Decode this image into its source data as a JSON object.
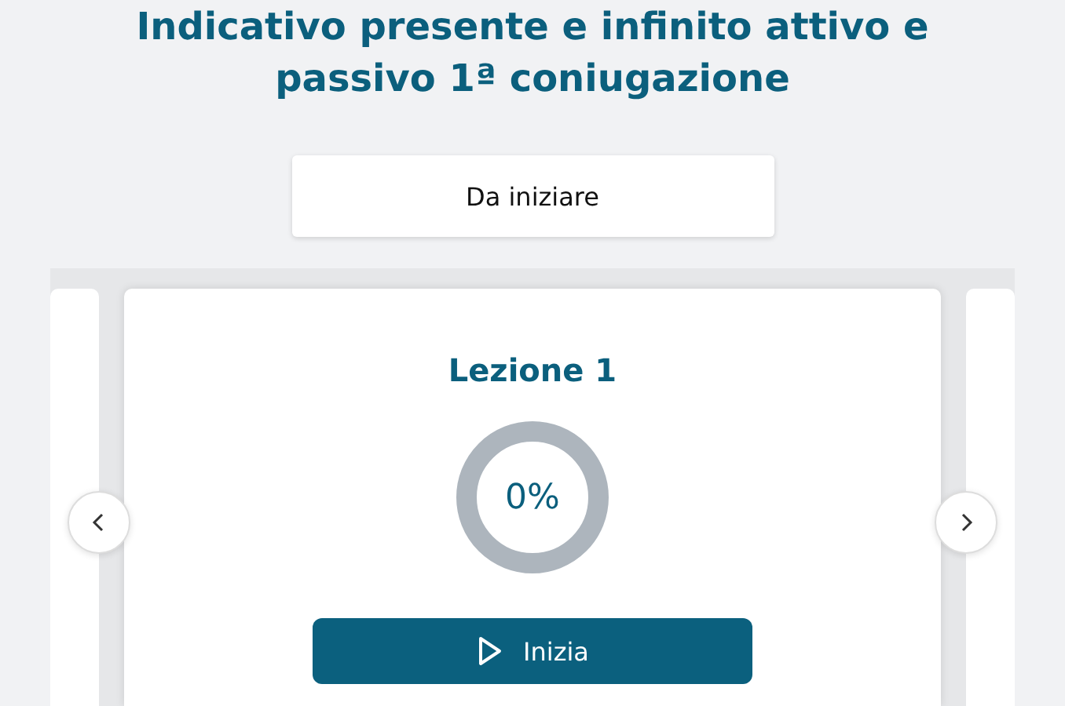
{
  "title": "Indicativo presente e infinito attivo e passivo 1ª coniugazione",
  "status": "Da iniziare",
  "lesson": {
    "title": "Lezione 1",
    "level": 0,
    "reading": "0%",
    "button": "Inizia"
  }
}
